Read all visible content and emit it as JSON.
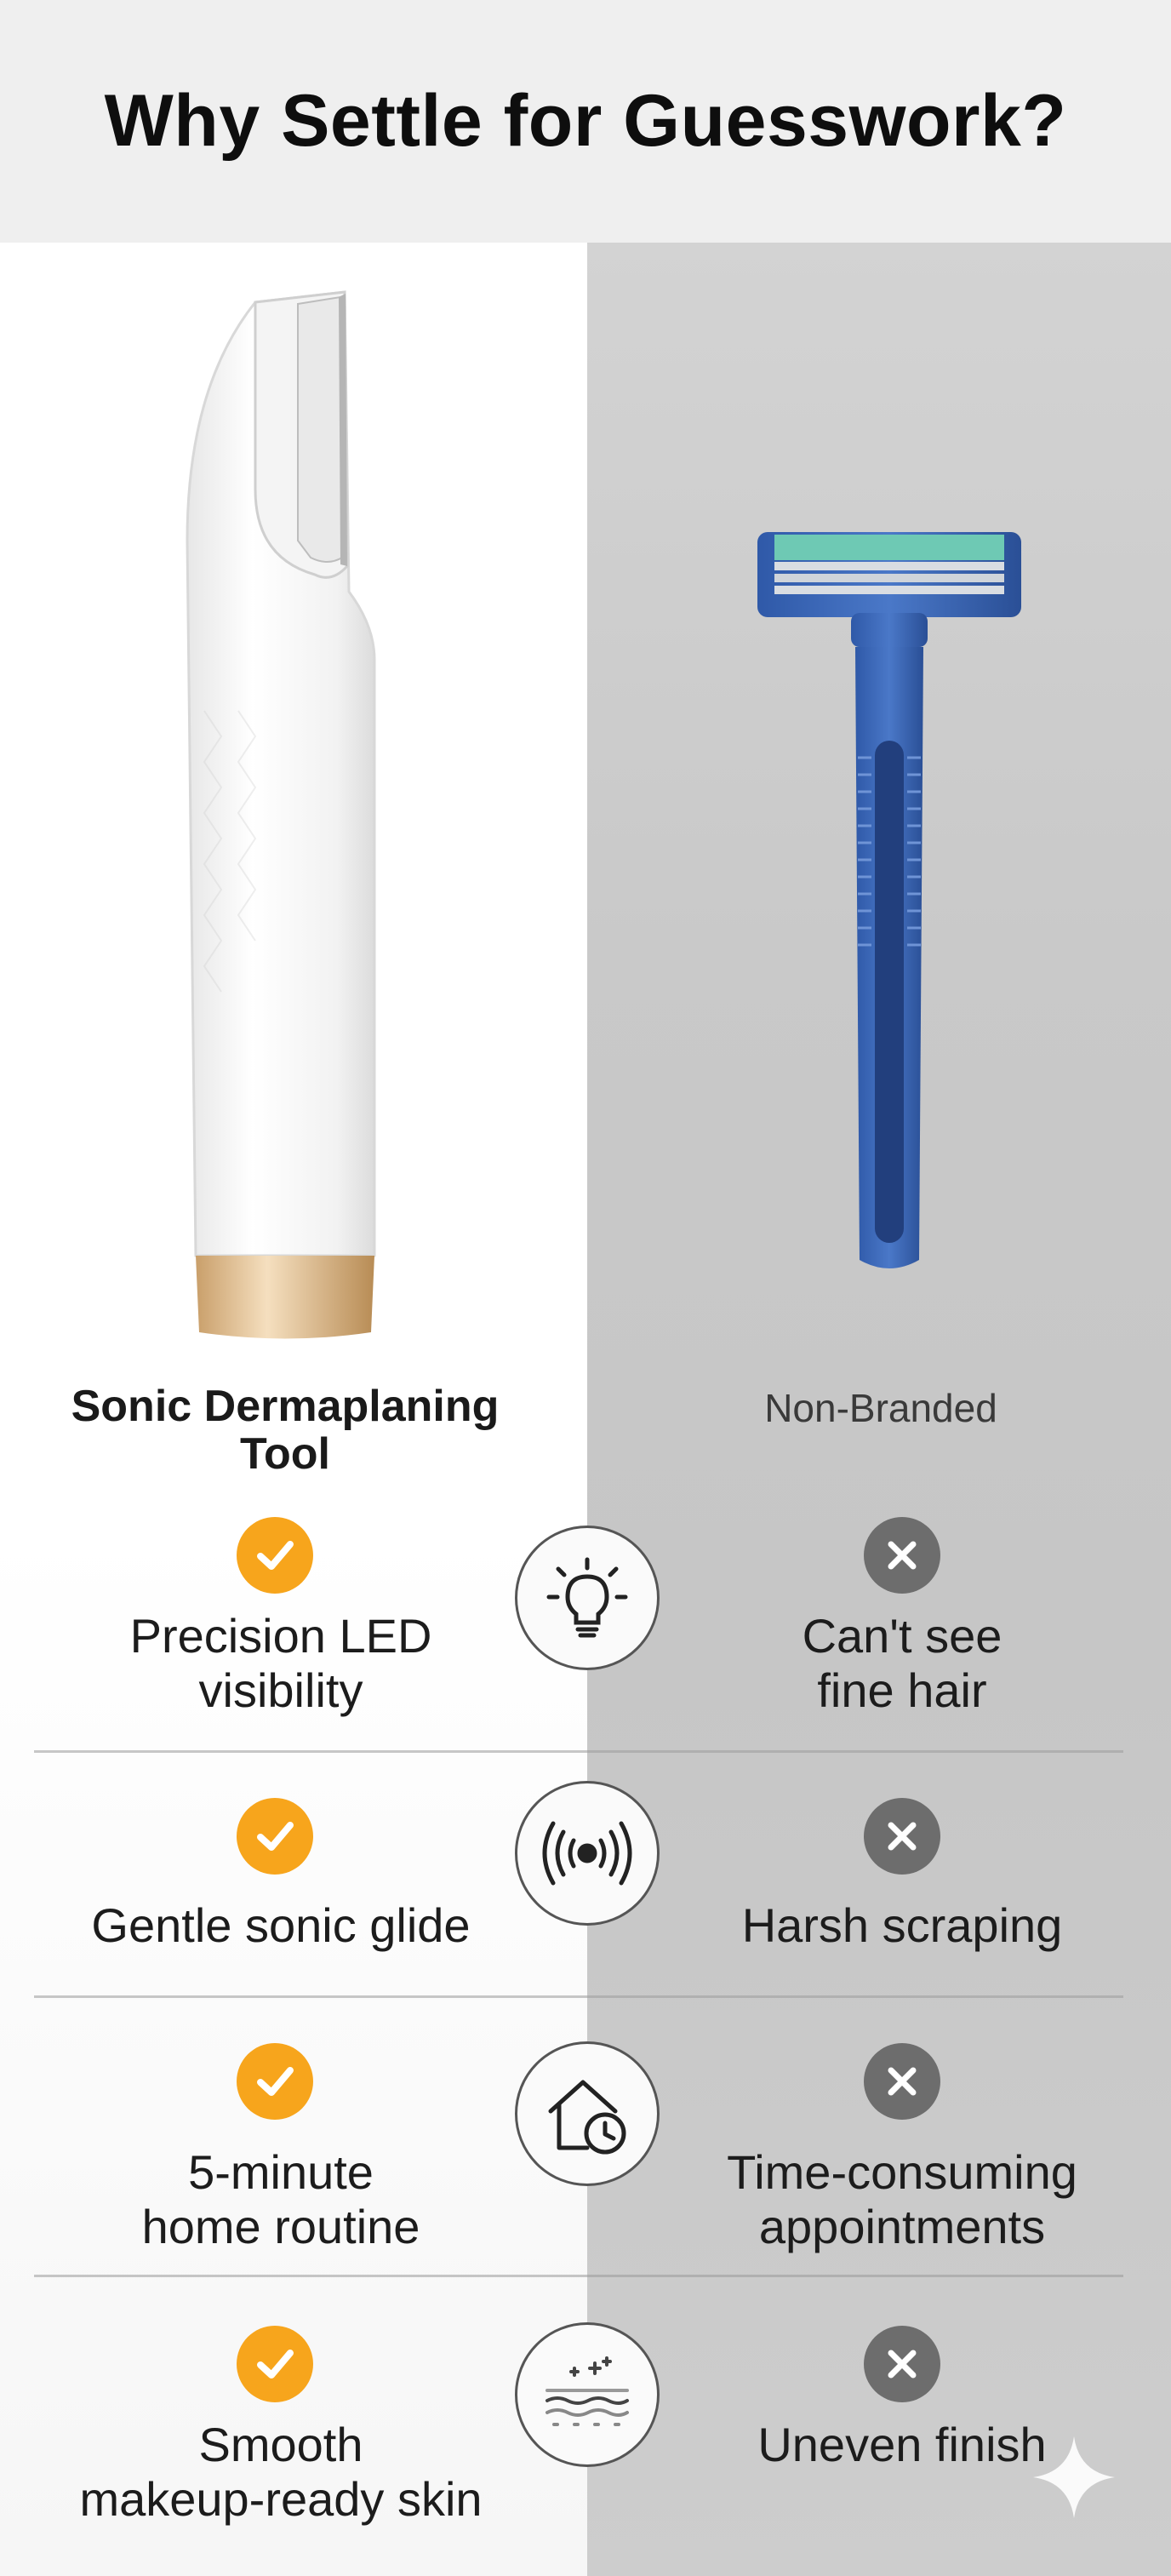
{
  "header": {
    "title": "Why Settle for Guesswork?"
  },
  "columns": {
    "left_title": "Sonic Dermaplaning\nTool",
    "right_title": "Non-Branded"
  },
  "rows": [
    {
      "icon": "bulb-icon",
      "left": "Precision LED\nvisibility",
      "right": "Can't see\nfine hair"
    },
    {
      "icon": "sonic-waves-icon",
      "left": "Gentle sonic glide",
      "right": "Harsh scraping"
    },
    {
      "icon": "home-clock-icon",
      "left": "5-minute\nhome routine",
      "right": "Time-consuming\nappointments"
    },
    {
      "icon": "smooth-skin-icon",
      "left": "Smooth\nmakeup-ready skin",
      "right": "Uneven finish"
    }
  ],
  "colors": {
    "check": "#f7a51c",
    "cross": "#6d6d6d",
    "right_bg": "#c9c9c9",
    "header_bg": "#efefef"
  }
}
